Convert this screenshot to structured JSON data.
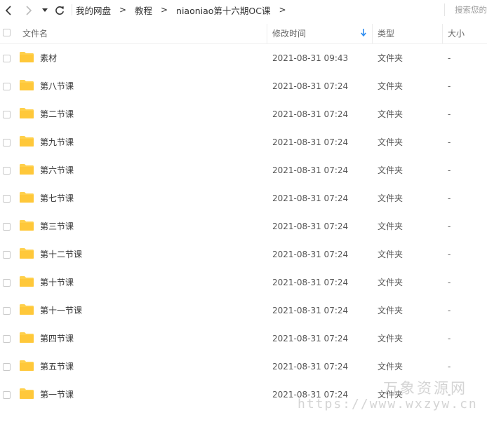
{
  "toolbar": {
    "breadcrumbs": [
      "我的网盘",
      "教程",
      "niaoniao第十六期OC课"
    ],
    "separator": ">",
    "search_placeholder": "搜索您的文件"
  },
  "columns": {
    "name": "文件名",
    "modified": "修改时间",
    "type": "类型",
    "size": "大小"
  },
  "sort": {
    "column": "modified",
    "direction": "descending"
  },
  "colors": {
    "folder": "#FFD04B",
    "sort_arrow": "#2d8cf0"
  },
  "files": [
    {
      "name": "素材",
      "modified": "2021-08-31 09:43",
      "type": "文件夹",
      "size": "-"
    },
    {
      "name": "第八节课",
      "modified": "2021-08-31 07:24",
      "type": "文件夹",
      "size": "-"
    },
    {
      "name": "第二节课",
      "modified": "2021-08-31 07:24",
      "type": "文件夹",
      "size": "-"
    },
    {
      "name": "第九节课",
      "modified": "2021-08-31 07:24",
      "type": "文件夹",
      "size": "-"
    },
    {
      "name": "第六节课",
      "modified": "2021-08-31 07:24",
      "type": "文件夹",
      "size": "-"
    },
    {
      "name": "第七节课",
      "modified": "2021-08-31 07:24",
      "type": "文件夹",
      "size": "-"
    },
    {
      "name": "第三节课",
      "modified": "2021-08-31 07:24",
      "type": "文件夹",
      "size": "-"
    },
    {
      "name": "第十二节课",
      "modified": "2021-08-31 07:24",
      "type": "文件夹",
      "size": "-"
    },
    {
      "name": "第十节课",
      "modified": "2021-08-31 07:24",
      "type": "文件夹",
      "size": "-"
    },
    {
      "name": "第十一节课",
      "modified": "2021-08-31 07:24",
      "type": "文件夹",
      "size": "-"
    },
    {
      "name": "第四节课",
      "modified": "2021-08-31 07:24",
      "type": "文件夹",
      "size": "-"
    },
    {
      "name": "第五节课",
      "modified": "2021-08-31 07:24",
      "type": "文件夹",
      "size": "-"
    },
    {
      "name": "第一节课",
      "modified": "2021-08-31 07:24",
      "type": "文件夹",
      "size": "-"
    }
  ],
  "watermark": {
    "line1": "万象资源网",
    "line2": "https://www.wxzyw.cn"
  }
}
